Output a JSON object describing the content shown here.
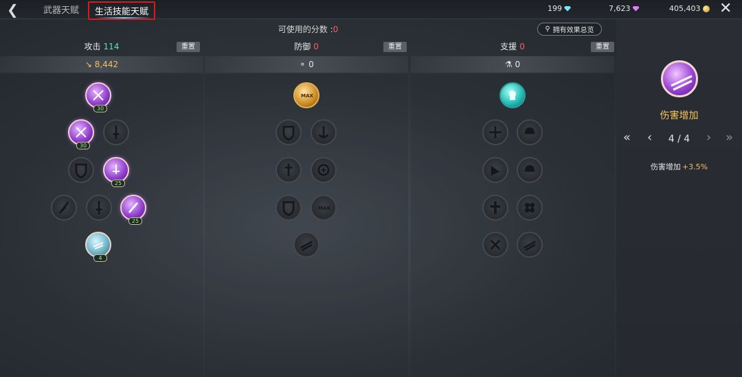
{
  "topbar": {
    "tabs": [
      {
        "label": "武器天赋"
      },
      {
        "label": "生活技能天赋"
      }
    ],
    "currencies": [
      {
        "value": "199",
        "icon": "blue-gem-icon"
      },
      {
        "value": "7,623",
        "icon": "purple-gem-icon"
      },
      {
        "value": "405,403",
        "icon": "gold-coin-icon"
      }
    ]
  },
  "points": {
    "label": "可使用的分数 :",
    "value": "0"
  },
  "overview_button": "拥有效果总览",
  "columns": [
    {
      "title": "攻击",
      "points": "114",
      "reset": "重置",
      "stat": "8,442",
      "stat_icon": "sword-icon"
    },
    {
      "title": "防御",
      "points": "0",
      "reset": "重置",
      "stat": "0",
      "stat_icon": "shield-icon"
    },
    {
      "title": "支援",
      "points": "0",
      "reset": "重置",
      "stat": "0",
      "stat_icon": "support-icon"
    }
  ],
  "nodes": {
    "attack": [
      {
        "level": "30"
      },
      {
        "level": "30"
      },
      {
        "level": "25"
      },
      {
        "level": "25"
      },
      {
        "level": "4"
      }
    ],
    "defense": [
      {
        "badge": "MAX"
      },
      {
        "badge": "MAX"
      }
    ]
  },
  "detail": {
    "name": "伤害增加",
    "page": "4 / 4",
    "effect_label": "伤害增加",
    "effect_value": "+3.5%"
  },
  "colors": {
    "accent_gold": "#f5c75a",
    "points_green": "#62e0b0",
    "points_red": "#ff5a5a",
    "highlight_red": "#d11f1f"
  }
}
